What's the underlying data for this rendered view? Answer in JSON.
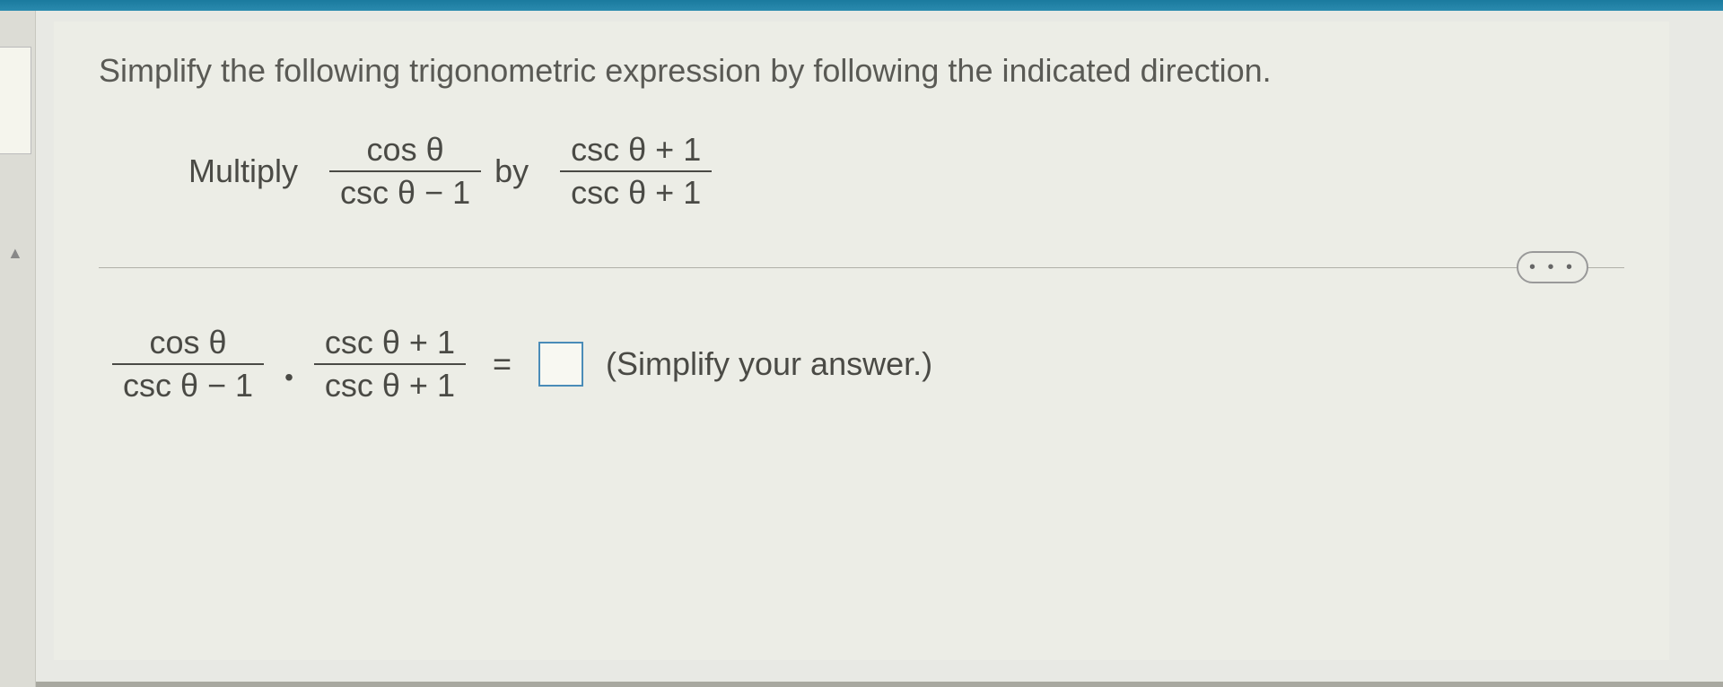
{
  "instruction": "Simplify the following trigonometric expression by following the indicated direction.",
  "multiply": {
    "label_multiply": "Multiply",
    "label_by": "by",
    "frac1_num": "cos  θ",
    "frac1_den": "csc  θ − 1",
    "frac2_num": "csc  θ + 1",
    "frac2_den": "csc  θ + 1"
  },
  "ellipsis": "• • •",
  "answer": {
    "frac1_num": "cos  θ",
    "frac1_den": "csc  θ − 1",
    "frac2_num": "csc  θ + 1",
    "frac2_den": "csc  θ + 1",
    "equals": "=",
    "dot": "•",
    "note": "(Simplify your answer.)"
  }
}
